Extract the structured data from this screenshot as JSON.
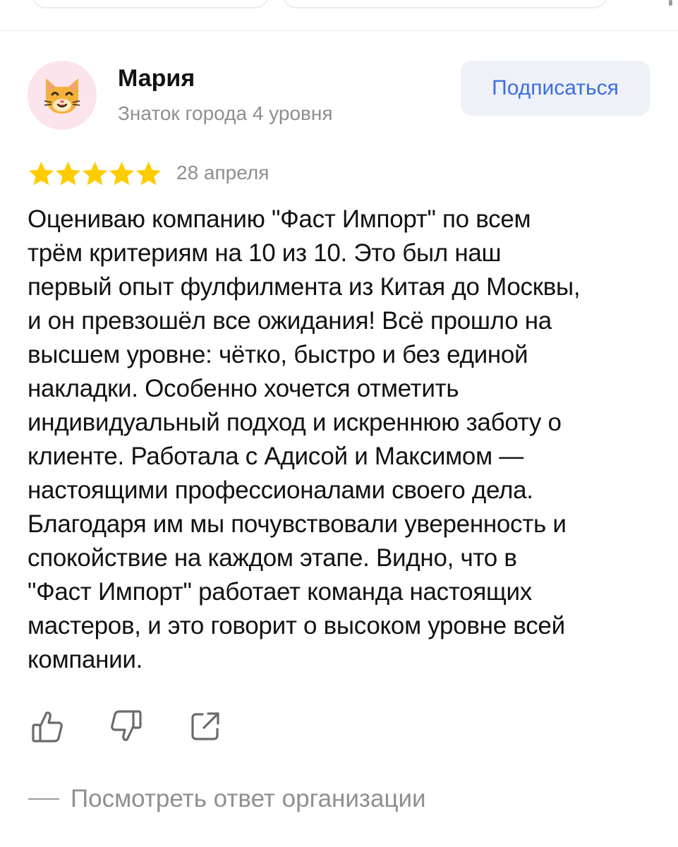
{
  "author": {
    "name": "Мария",
    "level": "Знаток города 4 уровня",
    "avatar_icon": "cat-face-icon"
  },
  "subscribe": {
    "label": "Подписаться"
  },
  "review": {
    "rating": 5,
    "rating_max": 5,
    "date": "28 апреля",
    "lines": [
      "Оцениваю компанию \"Фаст Импорт\" по всем",
      "трём критериям на 10 из 10. Это был наш",
      "первый опыт фулфилмента из Китая до Москвы,",
      "и он превзошёл все ожидания! Всё прошло на",
      "высшем уровне: чётко, быстро и без единой",
      "накладки. Особенно хочется отметить",
      "индивидуальный подход и искреннюю заботу о",
      "клиенте. Работала с Адисой и Максимом —",
      "настоящими профессионалами своего дела.",
      "Благодаря им мы почувствовали уверенность и",
      "спокойствие на каждом этапе. Видно, что в",
      "\"Фаст Импорт\" работает команда настоящих",
      "мастеров, и это говорит о высоком уровне всей",
      "компании."
    ]
  },
  "actions": {
    "like_icon": "thumbs-up-icon",
    "dislike_icon": "thumbs-down-icon",
    "share_icon": "share-icon"
  },
  "org_reply": {
    "label": "Посмотреть ответ организации"
  },
  "colors": {
    "star": "#ffcc00",
    "link_blue": "#3d6ee0",
    "button_bg": "#eef1f8",
    "muted_text": "#8f8f8f",
    "avatar_bg": "#fbe4ec"
  }
}
